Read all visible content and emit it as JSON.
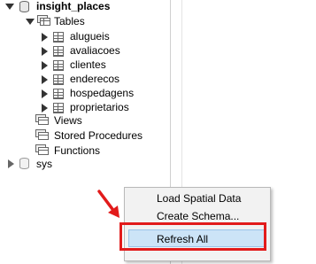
{
  "navigator": {
    "schema_name": "insight_places",
    "tables_folder": "Tables",
    "tables": [
      "alugueis",
      "avaliacoes",
      "clientes",
      "enderecos",
      "hospedagens",
      "proprietarios"
    ],
    "views_folder": "Views",
    "procedures_folder": "Stored Procedures",
    "functions_folder": "Functions",
    "other_schema": "sys"
  },
  "context_menu": {
    "items": [
      "Load Spatial Data",
      "Create Schema...",
      "Refresh All"
    ],
    "highlighted": "Refresh All"
  },
  "colors": {
    "callout": "#e21b1b",
    "highlight": "#cce4f7",
    "menu_bg": "#f2f2f2"
  }
}
